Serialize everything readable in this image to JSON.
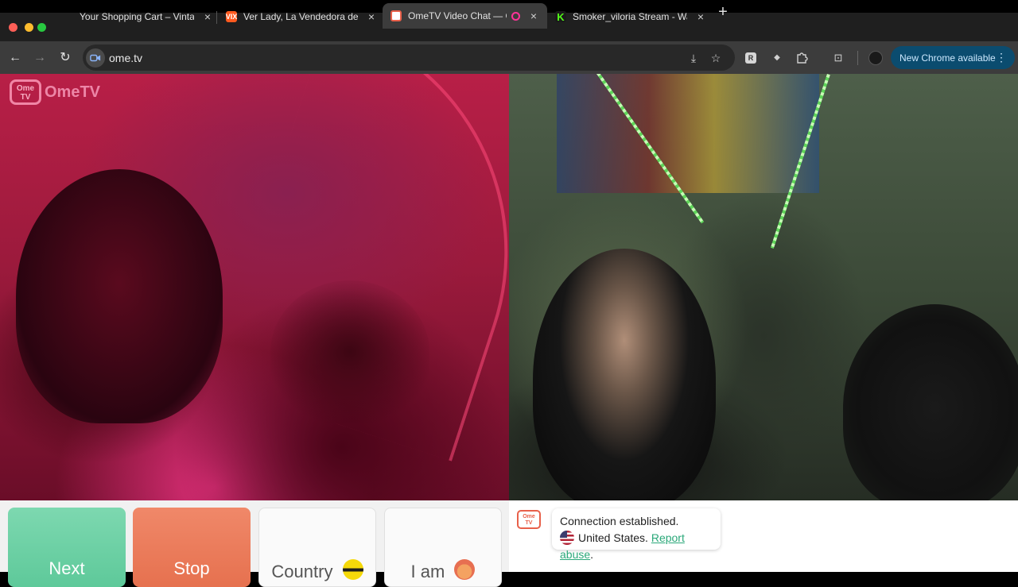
{
  "tabs": [
    {
      "title": "Your Shopping Cart – Vintage",
      "favicon": "blank",
      "close": "×"
    },
    {
      "title": "Ver Lady, La Vendedora de Ro",
      "favicon": "vix-logo",
      "favicon_text": "VIX",
      "close": "×"
    },
    {
      "title": "OmeTV Video Chat — Ome",
      "favicon": "ometv-logo",
      "recording": true,
      "close": "×"
    },
    {
      "title": "Smoker_viloria Stream - Watc",
      "favicon": "kick-logo",
      "favicon_text": "K",
      "close": "×"
    }
  ],
  "new_tab": "+",
  "toolbar": {
    "back": "←",
    "forward": "→",
    "reload": "↻",
    "url": "ome.tv",
    "site_icon": "video-camera-icon",
    "install_icon": "⤓",
    "bookmark_icon": "☆",
    "ext1": "R",
    "ext2": "◆",
    "extensions_icon": "puzzle-icon",
    "reading_icon": "⊡",
    "update_label": "New Chrome available",
    "menu_icon": "⋮"
  },
  "watermark": {
    "logo_top": "Ome",
    "logo_bottom": "TV",
    "text": "OmeTV"
  },
  "controls": {
    "next_label": "Next",
    "stop_label": "Stop",
    "country_label": "Country",
    "iam_label": "I am"
  },
  "chat": {
    "logo_top": "Ome",
    "logo_bottom": "TV",
    "message_line1": "Connection established.",
    "country": "United States.",
    "report_label": "Report abuse",
    "period": "."
  },
  "colors": {
    "next": "#5ec99a",
    "stop": "#e6714f",
    "report_link": "#2aa879",
    "update_button": "#0b4c6f"
  }
}
